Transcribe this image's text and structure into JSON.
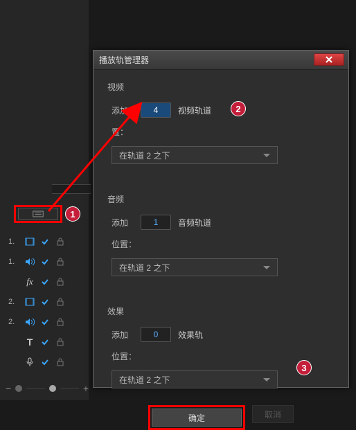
{
  "dialog": {
    "title": "播放轨管理器",
    "sections": {
      "video": {
        "header": "视频",
        "add_label": "添加",
        "add_value": "4",
        "track_label": "视频轨道",
        "pos_label": "置：",
        "pos_value": "在轨道 2 之下"
      },
      "audio": {
        "header": "音频",
        "add_label": "添加",
        "add_value": "1",
        "track_label": "音频轨道",
        "pos_label": "位置：",
        "pos_value": "在轨道 2 之下"
      },
      "effect": {
        "header": "效果",
        "add_label": "添加",
        "add_value": "0",
        "track_label": "效果轨",
        "pos_label": "位置：",
        "pos_value": "在轨道 2 之下"
      }
    },
    "ok": "确定",
    "cancel": "取消"
  },
  "tracks": {
    "r1": "1.",
    "r2": "1.",
    "fx": "fx",
    "r3": "2.",
    "r4": "2.",
    "t": "T"
  },
  "badges": {
    "b1": "1",
    "b2": "2",
    "b3": "3"
  }
}
